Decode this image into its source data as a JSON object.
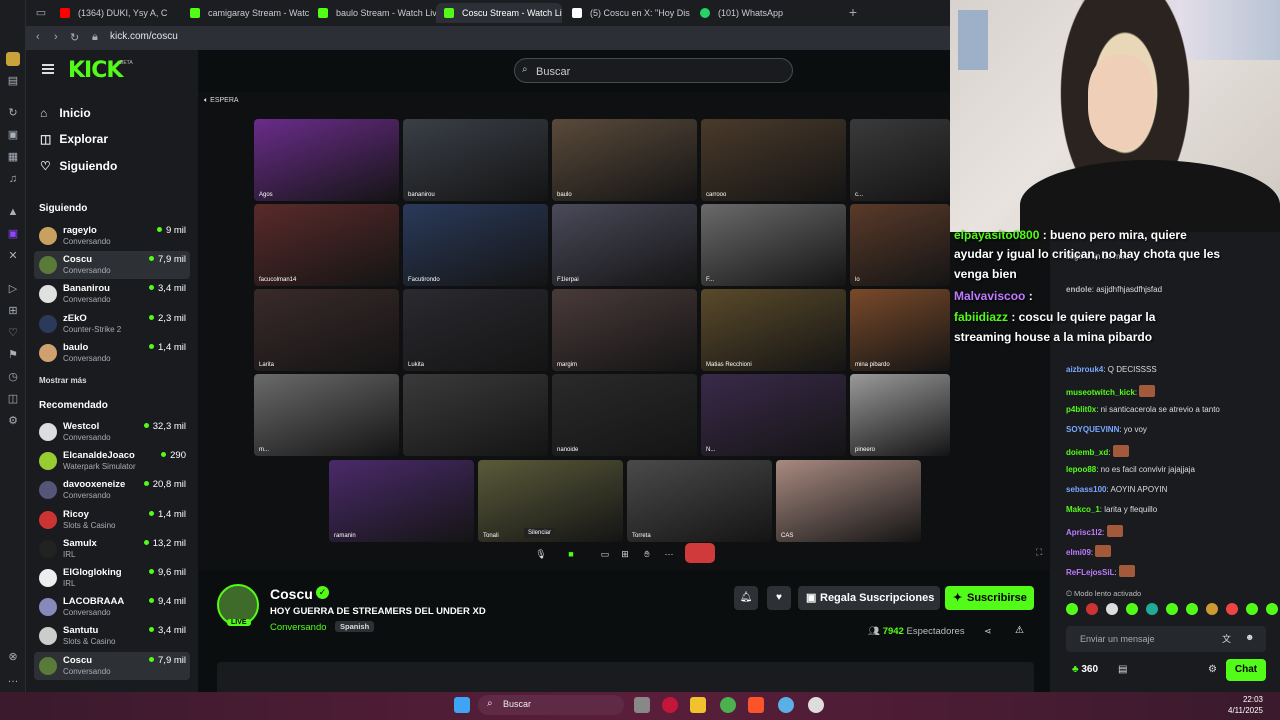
{
  "browser": {
    "tabs": [
      {
        "label": "(1364) DUKI, Ysy A, C",
        "icon_color": "#ff0000"
      },
      {
        "label": "camigaray Stream - Watc",
        "icon_color": "#53fc18"
      },
      {
        "label": "baulo Stream - Watch Liv",
        "icon_color": "#53fc18"
      },
      {
        "label": "Coscu Stream - Watch Li",
        "icon_color": "#53fc18"
      },
      {
        "label": "(5) Coscu en X: \"Hoy Dis",
        "icon_color": "#ffffff"
      },
      {
        "label": "(101) WhatsApp",
        "icon_color": "#25d366"
      }
    ],
    "url": "kick.com/coscu"
  },
  "kick": {
    "logo": "KICK",
    "logo_badge": "BETA",
    "search_placeholder": "Buscar",
    "nav": [
      {
        "label": "Inicio",
        "icon": "home-icon"
      },
      {
        "label": "Explorar",
        "icon": "compass-icon"
      },
      {
        "label": "Siguiendo",
        "icon": "heart-icon"
      }
    ],
    "following_title": "Siguiendo",
    "following": [
      {
        "name": "rageylo",
        "category": "Conversando",
        "viewers": "9 mil",
        "color": "#c8a060"
      },
      {
        "name": "Coscu",
        "category": "Conversando",
        "viewers": "7,9 mil",
        "color": "#5a7a3a"
      },
      {
        "name": "Bananirou",
        "category": "Conversando",
        "viewers": "3,4 mil",
        "color": "#e0e0e0"
      },
      {
        "name": "zEkO",
        "category": "Counter-Strike 2",
        "viewers": "2,3 mil",
        "color": "#2a3a5a"
      },
      {
        "name": "baulo",
        "category": "Conversando",
        "viewers": "1,4 mil",
        "color": "#d0a070"
      }
    ],
    "show_more": "Mostrar más",
    "recommended_title": "Recomendado",
    "recommended": [
      {
        "name": "Westcol",
        "category": "Conversando",
        "viewers": "32,3 mil",
        "color": "#ddd"
      },
      {
        "name": "ElcanaldeJoaco",
        "category": "Waterpark Simulator",
        "viewers": "290",
        "color": "#9c3"
      },
      {
        "name": "davooxeneize",
        "category": "Conversando",
        "viewers": "20,8 mil",
        "color": "#557"
      },
      {
        "name": "Ricoy",
        "category": "Slots & Casino",
        "viewers": "1,4 mil",
        "color": "#c33"
      },
      {
        "name": "Samulx",
        "category": "IRL",
        "viewers": "13,2 mil",
        "color": "#222"
      },
      {
        "name": "ElGlogloking",
        "category": "IRL",
        "viewers": "9,6 mil",
        "color": "#eee"
      },
      {
        "name": "LACOBRAAA",
        "category": "Conversando",
        "viewers": "9,4 mil",
        "color": "#88b"
      },
      {
        "name": "Santutu",
        "category": "Slots & Casino",
        "viewers": "3,4 mil",
        "color": "#ccc"
      },
      {
        "name": "Coscu",
        "category": "Conversando",
        "viewers": "7,9 mil",
        "color": "#5a7a3a"
      }
    ]
  },
  "player": {
    "status": "ESPERA",
    "tiles_row1": [
      "Agos",
      "bananirou",
      "baulo",
      "carrooo",
      "c..."
    ],
    "tiles_row2": [
      "facucolman14",
      "Facutirondo",
      "F1lerpai",
      "F...",
      "lo"
    ],
    "tiles_row3": [
      "Larita",
      "Lukita",
      "margim",
      "Matias Recchioni",
      "mina pibardo"
    ],
    "tiles_row4": [
      "m...",
      "",
      "nanoide",
      "N...",
      "pineero"
    ],
    "tiles_row5": [
      "ramanin",
      "Tonali",
      "Torreta",
      "CAS"
    ],
    "mute_tooltip": "Silenciar"
  },
  "stream": {
    "name": "Coscu",
    "live_badge": "LIVE",
    "title": "HOY GUERRA DE STREAMERS DEL UNDER XD",
    "category": "Conversando",
    "language": "Spanish",
    "gift_label": "Regala Suscripciones",
    "subscribe_label": "Suscribirse",
    "viewers": "7942",
    "viewers_label": "Espectadores"
  },
  "overlay_chat": [
    {
      "user": "elpayasito0800",
      "text": " : bueno pero mira, quiere"
    },
    {
      "user": "",
      "text": "ayudar y igual lo critican, no hay chota que les"
    },
    {
      "user": "",
      "text": "venga bien"
    },
    {
      "user": "Malvaviscoo",
      "text": " : "
    },
    {
      "user": "fabiidiazz",
      "text": " : coscu le quiere pagar la"
    },
    {
      "user": "",
      "text": "streaming house a la mina pibardo"
    }
  ],
  "chat": {
    "messages": [
      {
        "user": "",
        "text": "llego a fin de mes",
        "color": "#bbb"
      },
      {
        "user": "endole",
        "text": ": asjjdhfhjasdfhjsfad",
        "color": "#bbb"
      },
      {
        "user": "aizbrouk4",
        "text": ": Q DECISSSS",
        "color": "#7aa8ff"
      },
      {
        "user": "museotwitch_kick",
        "text": ":",
        "color": "#53fc18"
      },
      {
        "user": "p4blit0x",
        "text": ": ni santicacerola se atrevio a tanto",
        "color": "#53fc18"
      },
      {
        "user": "SOYQUEVINN",
        "text": ": yo voy",
        "color": "#7aa8ff"
      },
      {
        "user": "doiemb_xd",
        "text": ":",
        "color": "#53fc18"
      },
      {
        "user": "lepoo88",
        "text": ": no es facil convivir jajajjaja",
        "color": "#53fc18"
      },
      {
        "user": "sebass100",
        "text": ": AOYIN APOYIN",
        "color": "#7aa8ff"
      },
      {
        "user": "Makco_1",
        "text": ": larita y flequillo",
        "color": "#53fc18"
      },
      {
        "user": "Aprisc1l2",
        "text": ":",
        "color": "#c07aff"
      },
      {
        "user": "elmi09",
        "text": ":",
        "color": "#c07aff"
      },
      {
        "user": "ReFLejosSiL",
        "text": ":",
        "color": "#c07aff"
      }
    ],
    "slow_mode": "Modo lento activado",
    "input_placeholder": "Enviar un mensaje",
    "points": "360",
    "send_label": "Chat"
  },
  "taskbar": {
    "search_placeholder": "Buscar",
    "time": "22:03",
    "date": "4/11/2025"
  }
}
